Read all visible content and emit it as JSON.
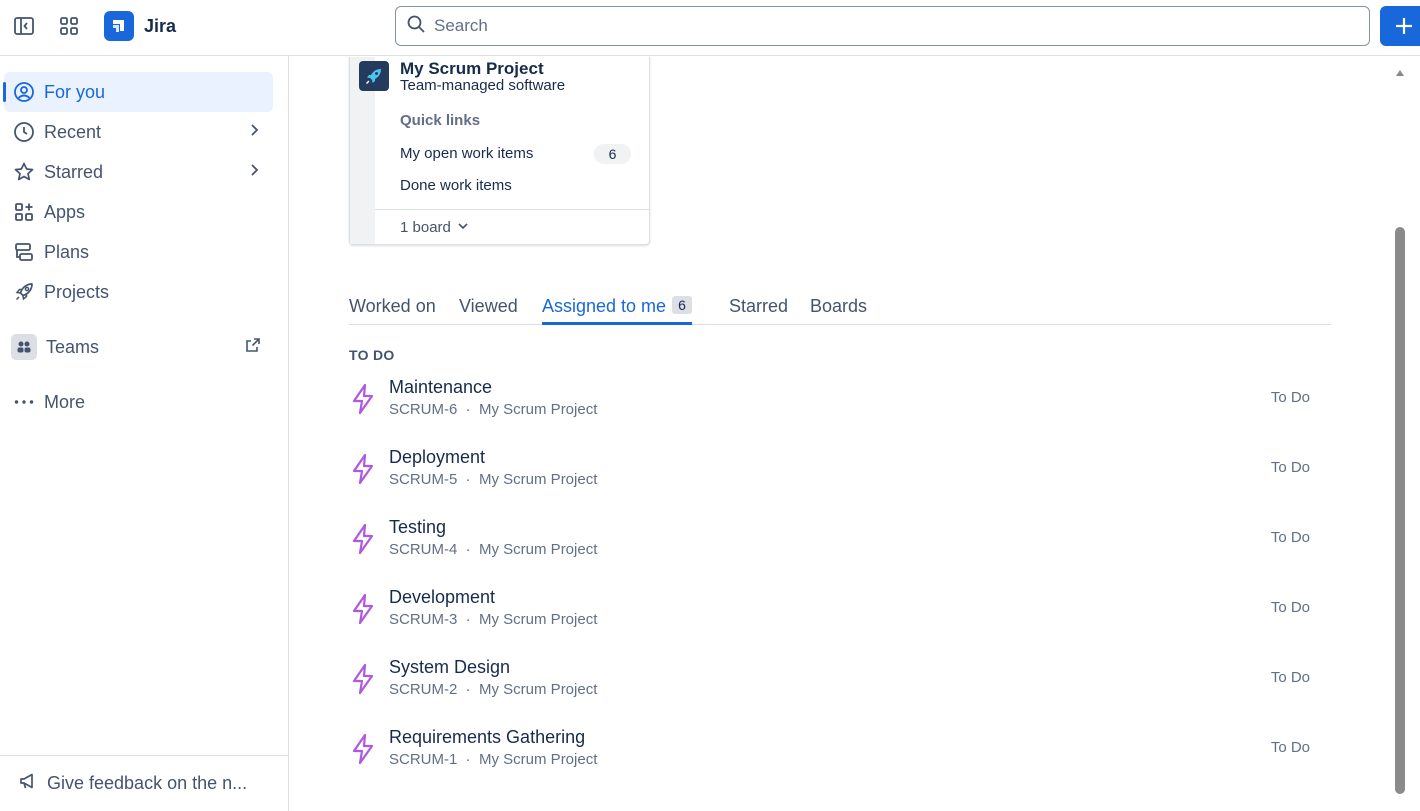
{
  "app": {
    "name": "Jira",
    "brand_color": "#1868db"
  },
  "search": {
    "placeholder": "Search"
  },
  "sidebar": {
    "items": [
      {
        "label": "For you",
        "icon": "user-circle-icon",
        "active": true
      },
      {
        "label": "Recent",
        "icon": "clock-icon"
      },
      {
        "label": "Starred",
        "icon": "star-icon"
      },
      {
        "label": "Apps",
        "icon": "apps-icon"
      },
      {
        "label": "Plans",
        "icon": "plans-icon"
      },
      {
        "label": "Projects",
        "icon": "rocket-icon"
      }
    ],
    "teams": {
      "label": "Teams",
      "icon": "teams-icon"
    },
    "more": {
      "label": "More",
      "icon": "more-icon"
    },
    "feedback": {
      "label": "Give feedback on the n...",
      "icon": "megaphone-icon"
    }
  },
  "project_card": {
    "name": "My Scrum Project",
    "type": "Team-managed software",
    "quick_links_title": "Quick links",
    "links": [
      {
        "label": "My open work items",
        "count": "6"
      },
      {
        "label": "Done work items"
      }
    ],
    "board_label": "1 board"
  },
  "tabs": [
    {
      "label": "Worked on"
    },
    {
      "label": "Viewed"
    },
    {
      "label": "Assigned to me",
      "badge": "6",
      "active": true
    },
    {
      "label": "Starred"
    },
    {
      "label": "Boards"
    }
  ],
  "section_title": "TO DO",
  "work_items": [
    {
      "title": "Maintenance",
      "key": "SCRUM-6",
      "project": "My Scrum Project",
      "status": "To Do"
    },
    {
      "title": "Deployment",
      "key": "SCRUM-5",
      "project": "My Scrum Project",
      "status": "To Do"
    },
    {
      "title": "Testing",
      "key": "SCRUM-4",
      "project": "My Scrum Project",
      "status": "To Do"
    },
    {
      "title": "Development",
      "key": "SCRUM-3",
      "project": "My Scrum Project",
      "status": "To Do"
    },
    {
      "title": "System Design",
      "key": "SCRUM-2",
      "project": "My Scrum Project",
      "status": "To Do"
    },
    {
      "title": "Requirements Gathering",
      "key": "SCRUM-1",
      "project": "My Scrum Project",
      "status": "To Do"
    }
  ],
  "colors": {
    "epic_purple": "#af59e1",
    "active_bg": "#e9f2fe"
  }
}
